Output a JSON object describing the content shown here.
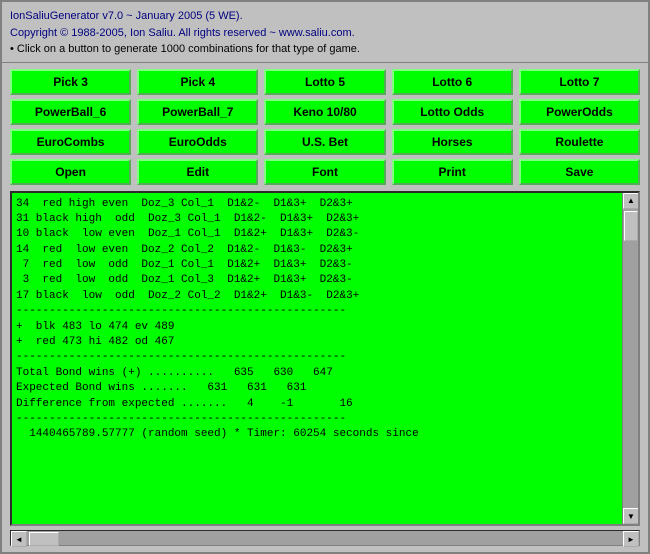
{
  "header": {
    "line1": "IonSaliuGenerator v7.0 ~ January 2005 (5 WE).",
    "line2": "Copyright © 1988-2005, Ion Saliu. All rights reserved ~ www.saliu.com.",
    "line3": "• Click on a button to generate 1000 combinations for that type of game."
  },
  "rows": [
    {
      "buttons": [
        {
          "label": "Pick 3",
          "name": "pick3-button"
        },
        {
          "label": "Pick 4",
          "name": "pick4-button"
        },
        {
          "label": "Lotto 5",
          "name": "lotto5-button"
        },
        {
          "label": "Lotto 6",
          "name": "lotto6-button"
        },
        {
          "label": "Lotto 7",
          "name": "lotto7-button"
        }
      ]
    },
    {
      "buttons": [
        {
          "label": "PowerBall_6",
          "name": "powerball6-button"
        },
        {
          "label": "PowerBall_7",
          "name": "powerball7-button"
        },
        {
          "label": "Keno 10/80",
          "name": "keno-button"
        },
        {
          "label": "Lotto Odds",
          "name": "lotto-odds-button"
        },
        {
          "label": "PowerOdds",
          "name": "power-odds-button"
        }
      ]
    },
    {
      "buttons": [
        {
          "label": "EuroCombs",
          "name": "euro-combs-button"
        },
        {
          "label": "EuroOdds",
          "name": "euro-odds-button"
        },
        {
          "label": "U.S. Bet",
          "name": "us-bet-button"
        },
        {
          "label": "Horses",
          "name": "horses-button"
        },
        {
          "label": "Roulette",
          "name": "roulette-button"
        }
      ]
    },
    {
      "buttons": [
        {
          "label": "Open",
          "name": "open-button"
        },
        {
          "label": "Edit",
          "name": "edit-button"
        },
        {
          "label": "Font",
          "name": "font-button"
        },
        {
          "label": "Print",
          "name": "print-button"
        },
        {
          "label": "Save",
          "name": "save-button"
        }
      ]
    }
  ],
  "output": {
    "text": "34  red high even  Doz_3 Col_1  D1&2-  D1&3+  D2&3+\n31 black high  odd  Doz_3 Col_1  D1&2-  D1&3+  D2&3+\n10 black  low even  Doz_1 Col_1  D1&2+  D1&3+  D2&3-\n14  red  low even  Doz_2 Col_2  D1&2-  D1&3-  D2&3+\n 7  red  low  odd  Doz_1 Col_1  D1&2+  D1&3+  D2&3-\n 3  red  low  odd  Doz_1 Col_3  D1&2+  D1&3+  D2&3-\n17 black  low  odd  Doz_2 Col_2  D1&2+  D1&3-  D2&3+\n--------------------------------------------------\n+  blk 483 lo 474 ev 489\n+  red 473 hi 482 od 467\n--------------------------------------------------\nTotal Bond wins (+) ..........   635   630   647\nExpected Bond wins .......   631   631   631\nDifference from expected .......   4    -1       16\n--------------------------------------------------\n  1440465789.57777 (random seed) * Timer: 60254 seconds since"
  },
  "scrollbar": {
    "up_arrow": "▲",
    "down_arrow": "▼",
    "left_arrow": "◄",
    "right_arrow": "►"
  }
}
